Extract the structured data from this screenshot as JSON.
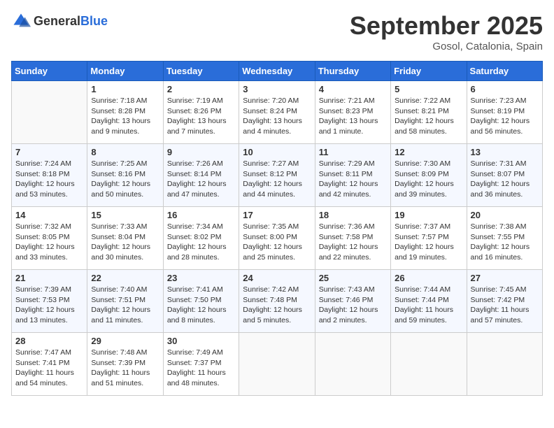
{
  "header": {
    "logo_general": "General",
    "logo_blue": "Blue",
    "month_title": "September 2025",
    "location": "Gosol, Catalonia, Spain"
  },
  "weekdays": [
    "Sunday",
    "Monday",
    "Tuesday",
    "Wednesday",
    "Thursday",
    "Friday",
    "Saturday"
  ],
  "weeks": [
    [
      {
        "day": "",
        "sunrise": "",
        "sunset": "",
        "daylight": ""
      },
      {
        "day": "1",
        "sunrise": "Sunrise: 7:18 AM",
        "sunset": "Sunset: 8:28 PM",
        "daylight": "Daylight: 13 hours and 9 minutes."
      },
      {
        "day": "2",
        "sunrise": "Sunrise: 7:19 AM",
        "sunset": "Sunset: 8:26 PM",
        "daylight": "Daylight: 13 hours and 7 minutes."
      },
      {
        "day": "3",
        "sunrise": "Sunrise: 7:20 AM",
        "sunset": "Sunset: 8:24 PM",
        "daylight": "Daylight: 13 hours and 4 minutes."
      },
      {
        "day": "4",
        "sunrise": "Sunrise: 7:21 AM",
        "sunset": "Sunset: 8:23 PM",
        "daylight": "Daylight: 13 hours and 1 minute."
      },
      {
        "day": "5",
        "sunrise": "Sunrise: 7:22 AM",
        "sunset": "Sunset: 8:21 PM",
        "daylight": "Daylight: 12 hours and 58 minutes."
      },
      {
        "day": "6",
        "sunrise": "Sunrise: 7:23 AM",
        "sunset": "Sunset: 8:19 PM",
        "daylight": "Daylight: 12 hours and 56 minutes."
      }
    ],
    [
      {
        "day": "7",
        "sunrise": "Sunrise: 7:24 AM",
        "sunset": "Sunset: 8:18 PM",
        "daylight": "Daylight: 12 hours and 53 minutes."
      },
      {
        "day": "8",
        "sunrise": "Sunrise: 7:25 AM",
        "sunset": "Sunset: 8:16 PM",
        "daylight": "Daylight: 12 hours and 50 minutes."
      },
      {
        "day": "9",
        "sunrise": "Sunrise: 7:26 AM",
        "sunset": "Sunset: 8:14 PM",
        "daylight": "Daylight: 12 hours and 47 minutes."
      },
      {
        "day": "10",
        "sunrise": "Sunrise: 7:27 AM",
        "sunset": "Sunset: 8:12 PM",
        "daylight": "Daylight: 12 hours and 44 minutes."
      },
      {
        "day": "11",
        "sunrise": "Sunrise: 7:29 AM",
        "sunset": "Sunset: 8:11 PM",
        "daylight": "Daylight: 12 hours and 42 minutes."
      },
      {
        "day": "12",
        "sunrise": "Sunrise: 7:30 AM",
        "sunset": "Sunset: 8:09 PM",
        "daylight": "Daylight: 12 hours and 39 minutes."
      },
      {
        "day": "13",
        "sunrise": "Sunrise: 7:31 AM",
        "sunset": "Sunset: 8:07 PM",
        "daylight": "Daylight: 12 hours and 36 minutes."
      }
    ],
    [
      {
        "day": "14",
        "sunrise": "Sunrise: 7:32 AM",
        "sunset": "Sunset: 8:05 PM",
        "daylight": "Daylight: 12 hours and 33 minutes."
      },
      {
        "day": "15",
        "sunrise": "Sunrise: 7:33 AM",
        "sunset": "Sunset: 8:04 PM",
        "daylight": "Daylight: 12 hours and 30 minutes."
      },
      {
        "day": "16",
        "sunrise": "Sunrise: 7:34 AM",
        "sunset": "Sunset: 8:02 PM",
        "daylight": "Daylight: 12 hours and 28 minutes."
      },
      {
        "day": "17",
        "sunrise": "Sunrise: 7:35 AM",
        "sunset": "Sunset: 8:00 PM",
        "daylight": "Daylight: 12 hours and 25 minutes."
      },
      {
        "day": "18",
        "sunrise": "Sunrise: 7:36 AM",
        "sunset": "Sunset: 7:58 PM",
        "daylight": "Daylight: 12 hours and 22 minutes."
      },
      {
        "day": "19",
        "sunrise": "Sunrise: 7:37 AM",
        "sunset": "Sunset: 7:57 PM",
        "daylight": "Daylight: 12 hours and 19 minutes."
      },
      {
        "day": "20",
        "sunrise": "Sunrise: 7:38 AM",
        "sunset": "Sunset: 7:55 PM",
        "daylight": "Daylight: 12 hours and 16 minutes."
      }
    ],
    [
      {
        "day": "21",
        "sunrise": "Sunrise: 7:39 AM",
        "sunset": "Sunset: 7:53 PM",
        "daylight": "Daylight: 12 hours and 13 minutes."
      },
      {
        "day": "22",
        "sunrise": "Sunrise: 7:40 AM",
        "sunset": "Sunset: 7:51 PM",
        "daylight": "Daylight: 12 hours and 11 minutes."
      },
      {
        "day": "23",
        "sunrise": "Sunrise: 7:41 AM",
        "sunset": "Sunset: 7:50 PM",
        "daylight": "Daylight: 12 hours and 8 minutes."
      },
      {
        "day": "24",
        "sunrise": "Sunrise: 7:42 AM",
        "sunset": "Sunset: 7:48 PM",
        "daylight": "Daylight: 12 hours and 5 minutes."
      },
      {
        "day": "25",
        "sunrise": "Sunrise: 7:43 AM",
        "sunset": "Sunset: 7:46 PM",
        "daylight": "Daylight: 12 hours and 2 minutes."
      },
      {
        "day": "26",
        "sunrise": "Sunrise: 7:44 AM",
        "sunset": "Sunset: 7:44 PM",
        "daylight": "Daylight: 11 hours and 59 minutes."
      },
      {
        "day": "27",
        "sunrise": "Sunrise: 7:45 AM",
        "sunset": "Sunset: 7:42 PM",
        "daylight": "Daylight: 11 hours and 57 minutes."
      }
    ],
    [
      {
        "day": "28",
        "sunrise": "Sunrise: 7:47 AM",
        "sunset": "Sunset: 7:41 PM",
        "daylight": "Daylight: 11 hours and 54 minutes."
      },
      {
        "day": "29",
        "sunrise": "Sunrise: 7:48 AM",
        "sunset": "Sunset: 7:39 PM",
        "daylight": "Daylight: 11 hours and 51 minutes."
      },
      {
        "day": "30",
        "sunrise": "Sunrise: 7:49 AM",
        "sunset": "Sunset: 7:37 PM",
        "daylight": "Daylight: 11 hours and 48 minutes."
      },
      {
        "day": "",
        "sunrise": "",
        "sunset": "",
        "daylight": ""
      },
      {
        "day": "",
        "sunrise": "",
        "sunset": "",
        "daylight": ""
      },
      {
        "day": "",
        "sunrise": "",
        "sunset": "",
        "daylight": ""
      },
      {
        "day": "",
        "sunrise": "",
        "sunset": "",
        "daylight": ""
      }
    ]
  ]
}
